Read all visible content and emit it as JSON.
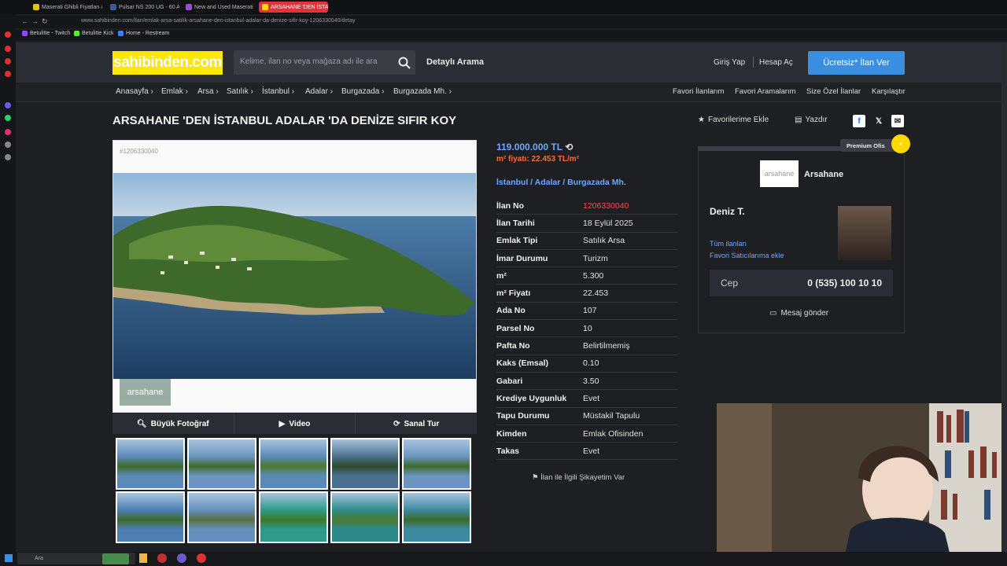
{
  "browser": {
    "tabs": [
      {
        "label": "Maserati Ghibli Fiyatları &",
        "color": "#e3c400"
      },
      {
        "label": "Pulsar NS 200 UG - 60 A",
        "color": "#3b5998"
      },
      {
        "label": "New and Used Maserati",
        "color": "#9b4dd6"
      },
      {
        "label": "ARSAHANE 'DEN İSTANE",
        "color": "#ffd900"
      }
    ],
    "url": "www.sahibinden.com/ilan/emlak-arsa-satilik-arsahane-den-istanbul-adalar-da-denize-sifir-koy-1206330040/detay",
    "bookmarks": [
      "Betulitte - Twitch",
      "Betulitte Kick",
      "Home - Restream"
    ]
  },
  "header": {
    "logo": "sahibinden.com",
    "search_placeholder": "Kelime, ilan no veya mağaza adı ile ara",
    "detailed_search": "Detaylı Arama",
    "login": "Giriş Yap",
    "register": "Hesap Aç",
    "post_ad": "Ücretsiz* İlan Ver"
  },
  "breadcrumb": [
    "Anasayfa",
    "Emlak",
    "Arsa",
    "Satılık",
    "İstanbul",
    "Adalar",
    "Burgazada",
    "Burgazada Mh."
  ],
  "toplinks": [
    "Favori İlanlarım",
    "Favori Aramalarım",
    "Size Özel İlanlar",
    "Karşılaştır"
  ],
  "listing": {
    "title": "ARSAHANE 'DEN İSTANBUL ADALAR 'DA DENİZE SIFIR KOY",
    "add_favorite": "Favorilerime Ekle",
    "print": "Yazdır",
    "ad_id_tag": "#1206330040",
    "watermark": "arsahane",
    "media": [
      "Büyük Fotoğraf",
      "Video",
      "Sanal Tur"
    ],
    "price": "119.000.000 TL",
    "m2_price": "m² fiyatı: 22.453 TL/m²",
    "location": [
      "İstanbul",
      "Adalar",
      "Burgazada Mh."
    ],
    "details": [
      {
        "k": "İlan No",
        "v": "1206330040"
      },
      {
        "k": "İlan Tarihi",
        "v": "18 Eylül 2025"
      },
      {
        "k": "Emlak Tipi",
        "v": "Satılık Arsa"
      },
      {
        "k": "İmar Durumu",
        "v": "Turizm"
      },
      {
        "k": "m²",
        "v": "5.300"
      },
      {
        "k": "m² Fiyatı",
        "v": "22.453"
      },
      {
        "k": "Ada No",
        "v": "107"
      },
      {
        "k": "Parsel No",
        "v": "10"
      },
      {
        "k": "Pafta No",
        "v": "Belirtilmemiş"
      },
      {
        "k": "Kaks (Emsal)",
        "v": "0.10"
      },
      {
        "k": "Gabari",
        "v": "3.50"
      },
      {
        "k": "Krediye Uygunluk",
        "v": "Evet"
      },
      {
        "k": "Tapu Durumu",
        "v": "Müstakil Tapulu"
      },
      {
        "k": "Kimden",
        "v": "Emlak Ofisinden"
      },
      {
        "k": "Takas",
        "v": "Evet"
      }
    ],
    "report": "İlan ile İlgili Şikayetim Var"
  },
  "seller": {
    "badge": "Premium Ofis",
    "logo_text": "arsahane",
    "name": "Arsahane",
    "agent": "Deniz T.",
    "all_ads": "Tüm ilanları",
    "add_fav_seller": "Favori Satıcılarıma ekle",
    "phone_label": "Cep",
    "phone": "0 (535) 100 10 10",
    "message": "Mesaj gönder"
  },
  "taskbar": {
    "search": "Ara"
  },
  "colors": {
    "accent": "#3b8fe0",
    "logo_bg": "#ffe800",
    "price": "#6ea8ff",
    "highlight": "#ff6a3a"
  }
}
